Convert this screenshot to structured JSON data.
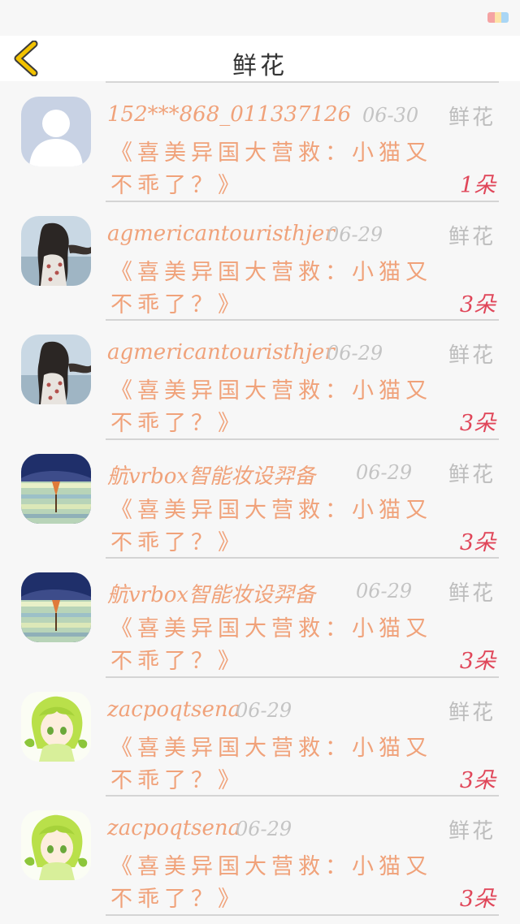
{
  "header": {
    "title": "鲜花"
  },
  "items": [
    {
      "name": "152***868_011337126",
      "date": "06-30",
      "tag": "鲜花",
      "line1": "《喜美异国大营救：小猫又",
      "line2": "不乖了？》",
      "count": "1朵",
      "avatar": "default-avatar"
    },
    {
      "name": "agmericantouristhjer",
      "date": "06-29",
      "tag": "鲜花",
      "line1": "《喜美异国大营救：小猫又",
      "line2": "不乖了？》",
      "count": "3朵",
      "avatar": "girl-photo"
    },
    {
      "name": "agmericantouristhjer",
      "date": "06-29",
      "tag": "鲜花",
      "line1": "《喜美异国大营救：小猫又",
      "line2": "不乖了？》",
      "count": "3朵",
      "avatar": "girl-photo"
    },
    {
      "name": "航vrbox智能妆设羿备",
      "date": "06-29",
      "tag": "鲜花",
      "line1": "《喜美异国大营救：小猫又",
      "line2": "不乖了？》",
      "count": "3朵",
      "avatar": "artwork"
    },
    {
      "name": "航vrbox智能妆设羿备",
      "date": "06-29",
      "tag": "鲜花",
      "line1": "《喜美异国大营救：小猫又",
      "line2": "不乖了？》",
      "count": "3朵",
      "avatar": "artwork"
    },
    {
      "name": "zacpoqtsena",
      "date": "06-29",
      "tag": "鲜花",
      "line1": "《喜美异国大营救：小猫又",
      "line2": "不乖了？》",
      "count": "3朵",
      "avatar": "anime-girl"
    },
    {
      "name": "zacpoqtsena",
      "date": "06-29",
      "tag": "鲜花",
      "line1": "《喜美异国大营救：小猫又",
      "line2": "不乖了？》",
      "count": "3朵",
      "avatar": "anime-girl"
    }
  ],
  "colors": {
    "accent": "#f0a27a",
    "count": "#e0475a",
    "muted": "#bdbdbd",
    "back": "#f2c200"
  }
}
